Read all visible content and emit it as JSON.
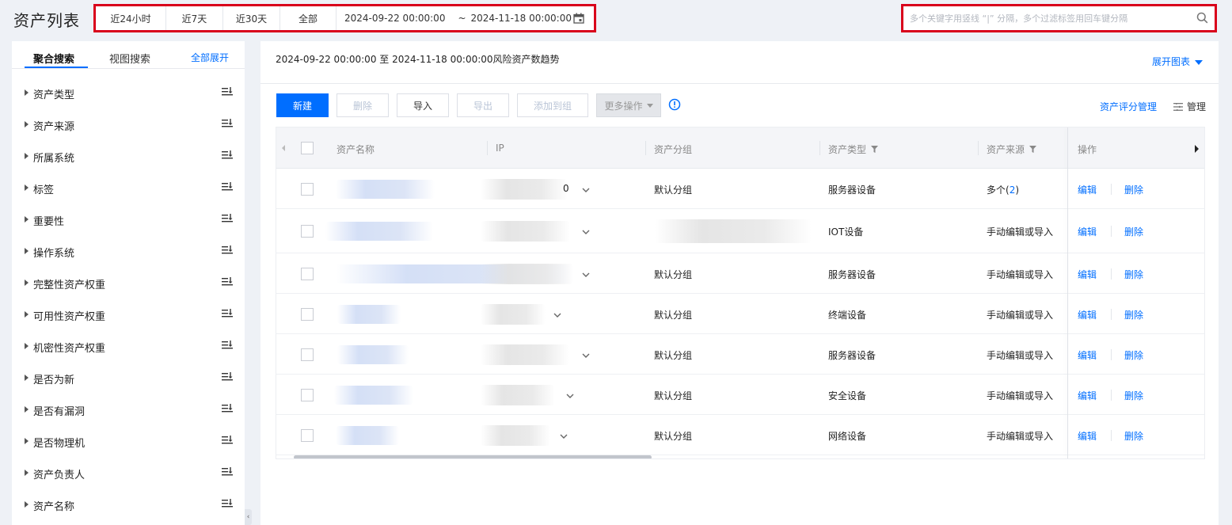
{
  "header": {
    "title": "资产列表",
    "time_buttons": [
      "近24小时",
      "近7天",
      "近30天",
      "全部"
    ],
    "range_start": "2024-09-22 00:00:00",
    "range_sep": "~",
    "range_end": "2024-11-18 00:00:00",
    "search_placeholder": "多个关键字用竖线 “|” 分隔，多个过滤标签用回车键分隔"
  },
  "sidebar": {
    "tabs": [
      "聚合搜索",
      "视图搜索"
    ],
    "expand_all": "全部展开",
    "facets": [
      "资产类型",
      "资产来源",
      "所属系统",
      "标签",
      "重要性",
      "操作系统",
      "完整性资产权重",
      "可用性资产权重",
      "机密性资产权重",
      "是否为新",
      "是否有漏洞",
      "是否物理机",
      "资产负责人",
      "资产名称"
    ]
  },
  "trend": {
    "title": "2024-09-22 00:00:00 至 2024-11-18 00:00:00风险资产数趋势",
    "show_chart": "展开图表"
  },
  "toolbar": {
    "new": "新建",
    "delete": "删除",
    "import": "导入",
    "export": "导出",
    "add_to_group": "添加到组",
    "more": "更多操作",
    "score_manage": "资产评分管理",
    "manage": "管理"
  },
  "table": {
    "columns": {
      "name": "资产名称",
      "ip": "IP",
      "group": "资产分组",
      "type": "资产类型",
      "source": "资产来源",
      "ops": "操作"
    },
    "edit": "编辑",
    "remove": "删除",
    "rows": [
      {
        "ip_tail": "0",
        "group": "默认分组",
        "type": "服务器设备",
        "source": "多个(",
        "source_count": "2",
        "source_close": ")"
      },
      {
        "ip_tail": "",
        "group": "",
        "type": "IOT设备",
        "source": "手动编辑或导入",
        "source_count": "",
        "source_close": ""
      },
      {
        "ip_tail": "",
        "group": "默认分组",
        "type": "服务器设备",
        "source": "手动编辑或导入",
        "source_count": "",
        "source_close": ""
      },
      {
        "ip_tail": "",
        "group": "默认分组",
        "type": "终端设备",
        "source": "手动编辑或导入",
        "source_count": "",
        "source_close": ""
      },
      {
        "ip_tail": "",
        "group": "默认分组",
        "type": "服务器设备",
        "source": "手动编辑或导入",
        "source_count": "",
        "source_close": ""
      },
      {
        "ip_tail": "",
        "group": "默认分组",
        "type": "安全设备",
        "source": "手动编辑或导入",
        "source_count": "",
        "source_close": ""
      },
      {
        "ip_tail": "",
        "group": "默认分组",
        "type": "网络设备",
        "source": "手动编辑或导入",
        "source_count": "",
        "source_close": ""
      }
    ]
  }
}
